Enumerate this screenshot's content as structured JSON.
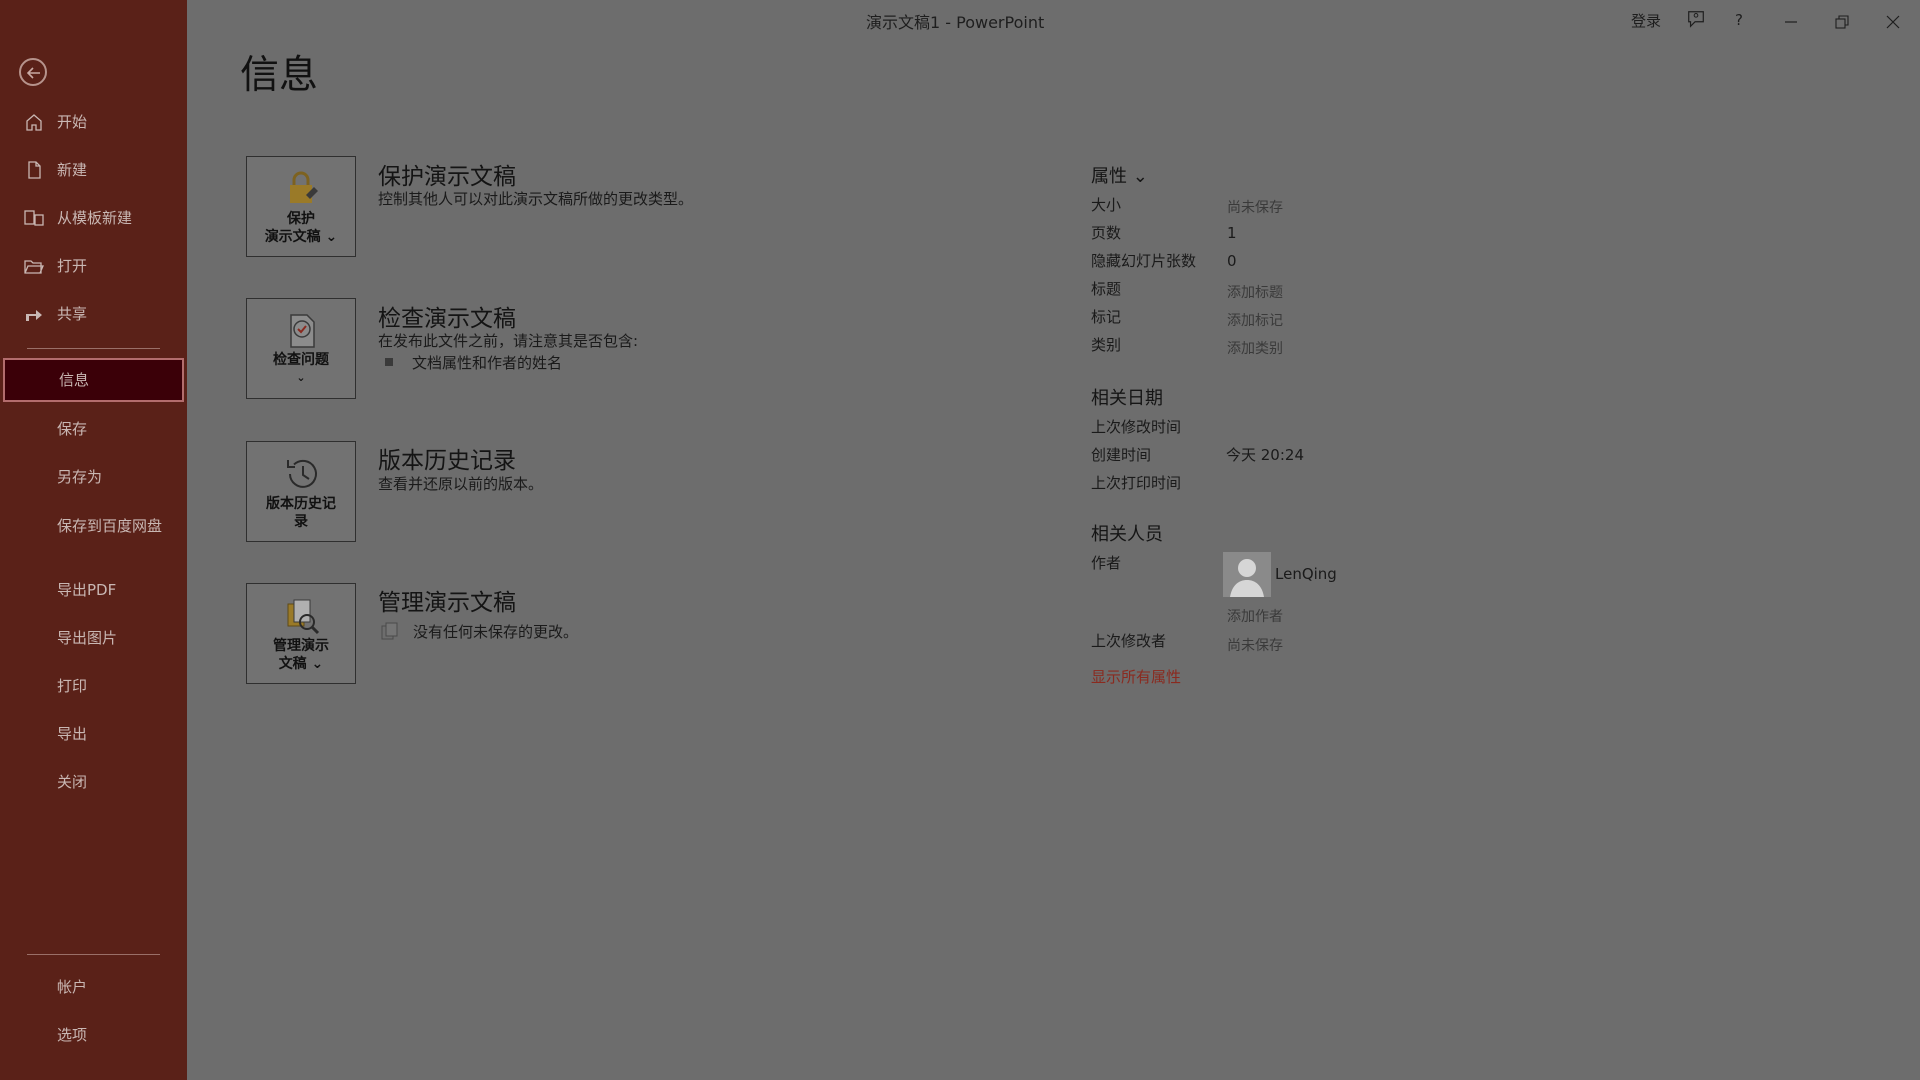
{
  "window": {
    "title": "演示文稿1  -  PowerPoint",
    "signin": "登录"
  },
  "sidebar": {
    "items": [
      {
        "label": "开始",
        "icon": "home-icon"
      },
      {
        "label": "新建",
        "icon": "new-doc-icon"
      },
      {
        "label": "从模板新建",
        "icon": "template-icon"
      },
      {
        "label": "打开",
        "icon": "open-folder-icon"
      },
      {
        "label": "共享",
        "icon": "share-icon"
      },
      {
        "label": "信息",
        "active": true
      },
      {
        "label": "保存"
      },
      {
        "label": "另存为"
      },
      {
        "label": "保存到百度网盘"
      },
      {
        "label": "导出PDF"
      },
      {
        "label": "导出图片"
      },
      {
        "label": "打印"
      },
      {
        "label": "导出"
      },
      {
        "label": "关闭"
      }
    ],
    "bottom": [
      {
        "label": "帐户"
      },
      {
        "label": "选项"
      }
    ]
  },
  "page": {
    "title": "信息"
  },
  "cards": [
    {
      "button": [
        "保护",
        "演示文稿 ⌄"
      ],
      "title": "保护演示文稿",
      "desc": "控制其他人可以对此演示文稿所做的更改类型。"
    },
    {
      "button": [
        "检查问题",
        "⌄"
      ],
      "title": "检查演示文稿",
      "desc": "在发布此文件之前，请注意其是否包含:",
      "bullet": "文档属性和作者的姓名"
    },
    {
      "button": [
        "版本历史记",
        "录"
      ],
      "title": "版本历史记录",
      "desc": "查看并还原以前的版本。"
    },
    {
      "button": [
        "管理演示",
        "文稿 ⌄"
      ],
      "title": "管理演示文稿",
      "desc": "没有任何未保存的更改。"
    }
  ],
  "properties": {
    "header": "属性 ⌄",
    "rows": [
      {
        "label": "大小",
        "value": "尚未保存"
      },
      {
        "label": "页数",
        "value": "1"
      },
      {
        "label": "隐藏幻灯片张数",
        "value": "0"
      },
      {
        "label": "标题",
        "value": "添加标题"
      },
      {
        "label": "标记",
        "value": "添加标记"
      },
      {
        "label": "类别",
        "value": "添加类别"
      }
    ],
    "dates_header": "相关日期",
    "dates": [
      {
        "label": "上次修改时间",
        "value": ""
      },
      {
        "label": "创建时间",
        "value": "今天 20:24"
      },
      {
        "label": "上次打印时间",
        "value": ""
      }
    ],
    "people_header": "相关人员",
    "author_label": "作者",
    "author_name": "LenQing",
    "add_author": "添加作者",
    "last_modified_by_label": "上次修改者",
    "last_modified_by_value": "尚未保存",
    "show_all": "显示所有属性"
  }
}
